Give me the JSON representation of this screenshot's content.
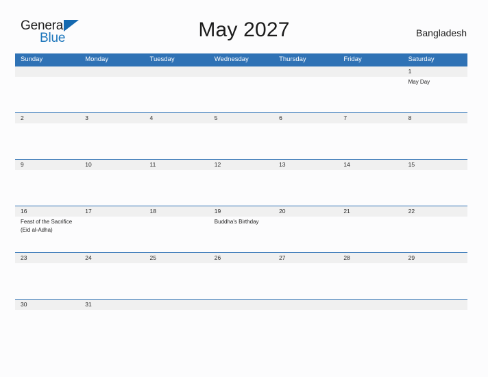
{
  "brand": {
    "name_part1": "General",
    "name_part2": "Blue",
    "flag_icon": "blue-triangle-flag"
  },
  "header": {
    "title": "May 2027",
    "region": "Bangladesh"
  },
  "calendar": {
    "weekday_headers": [
      "Sunday",
      "Monday",
      "Tuesday",
      "Wednesday",
      "Thursday",
      "Friday",
      "Saturday"
    ],
    "colors": {
      "header_blue": "#2f72b5",
      "band_gray": "#f0f0f0",
      "brand_blue": "#1b75bb",
      "page_background": "#fcfcfd"
    },
    "weeks": [
      {
        "days": [
          {
            "num": "",
            "event": ""
          },
          {
            "num": "",
            "event": ""
          },
          {
            "num": "",
            "event": ""
          },
          {
            "num": "",
            "event": ""
          },
          {
            "num": "",
            "event": ""
          },
          {
            "num": "",
            "event": ""
          },
          {
            "num": "1",
            "event": "May Day"
          }
        ]
      },
      {
        "days": [
          {
            "num": "2",
            "event": ""
          },
          {
            "num": "3",
            "event": ""
          },
          {
            "num": "4",
            "event": ""
          },
          {
            "num": "5",
            "event": ""
          },
          {
            "num": "6",
            "event": ""
          },
          {
            "num": "7",
            "event": ""
          },
          {
            "num": "8",
            "event": ""
          }
        ]
      },
      {
        "days": [
          {
            "num": "9",
            "event": ""
          },
          {
            "num": "10",
            "event": ""
          },
          {
            "num": "11",
            "event": ""
          },
          {
            "num": "12",
            "event": ""
          },
          {
            "num": "13",
            "event": ""
          },
          {
            "num": "14",
            "event": ""
          },
          {
            "num": "15",
            "event": ""
          }
        ]
      },
      {
        "days": [
          {
            "num": "16",
            "event": "Feast of the Sacrifice (Eid al-Adha)"
          },
          {
            "num": "17",
            "event": ""
          },
          {
            "num": "18",
            "event": ""
          },
          {
            "num": "19",
            "event": "Buddha's Birthday"
          },
          {
            "num": "20",
            "event": ""
          },
          {
            "num": "21",
            "event": ""
          },
          {
            "num": "22",
            "event": ""
          }
        ]
      },
      {
        "days": [
          {
            "num": "23",
            "event": ""
          },
          {
            "num": "24",
            "event": ""
          },
          {
            "num": "25",
            "event": ""
          },
          {
            "num": "26",
            "event": ""
          },
          {
            "num": "27",
            "event": ""
          },
          {
            "num": "28",
            "event": ""
          },
          {
            "num": "29",
            "event": ""
          }
        ]
      },
      {
        "days": [
          {
            "num": "30",
            "event": ""
          },
          {
            "num": "31",
            "event": ""
          },
          {
            "num": "",
            "event": ""
          },
          {
            "num": "",
            "event": ""
          },
          {
            "num": "",
            "event": ""
          },
          {
            "num": "",
            "event": ""
          },
          {
            "num": "",
            "event": ""
          }
        ]
      }
    ]
  }
}
